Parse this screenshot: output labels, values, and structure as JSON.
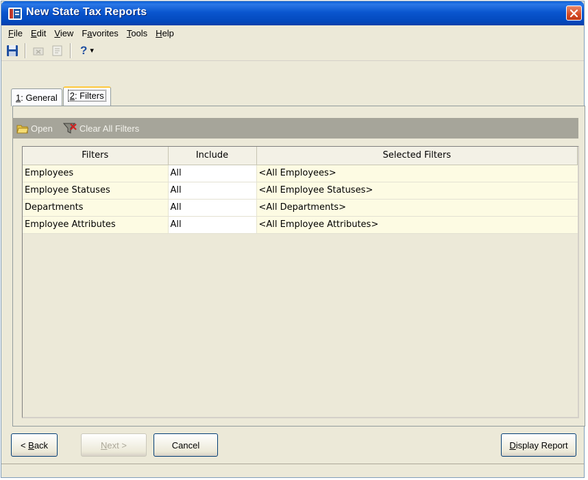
{
  "window": {
    "title": "New State Tax Reports"
  },
  "menu": [
    {
      "label": "File",
      "accel": "F",
      "rest": "ile"
    },
    {
      "label": "Edit",
      "accel": "E",
      "rest": "dit"
    },
    {
      "label": "View",
      "accel": "V",
      "rest": "iew"
    },
    {
      "label": "Favorites",
      "pre": "F",
      "accel": "a",
      "rest": "vorites"
    },
    {
      "label": "Tools",
      "accel": "T",
      "rest": "ools"
    },
    {
      "label": "Help",
      "accel": "H",
      "rest": "elp"
    }
  ],
  "toolbar": {
    "icons": [
      "save-icon",
      "delete-icon",
      "properties-icon",
      "help-icon"
    ],
    "help_glyph": "?",
    "dropdown_glyph": "▾"
  },
  "tabs": [
    {
      "num": "1",
      "label": ": General"
    },
    {
      "num": "2",
      "label": ": Filters"
    }
  ],
  "actions": {
    "open_label": "Open",
    "clear_label": "Clear All Filters"
  },
  "grid": {
    "headers": [
      "Filters",
      "Include",
      "Selected Filters"
    ],
    "rows": [
      {
        "filter": "Employees",
        "include": "All",
        "selected": "<All Employees>"
      },
      {
        "filter": "Employee Statuses",
        "include": "All",
        "selected": "<All Employee Statuses>"
      },
      {
        "filter": "Departments",
        "include": "All",
        "selected": "<All Departments>"
      },
      {
        "filter": "Employee Attributes",
        "include": "All",
        "selected": "<All Employee Attributes>"
      }
    ]
  },
  "buttons": {
    "back_prefix": "< ",
    "back_accel": "B",
    "back_rest": "ack",
    "next_accel": "N",
    "next_rest": "ext >",
    "cancel_label": "Cancel",
    "display_accel": "D",
    "display_rest": "isplay Report"
  },
  "colors": {
    "titlebar": "#0348bc",
    "actionbar": "#a6a59a",
    "row_alt": "#fdfbe3"
  }
}
